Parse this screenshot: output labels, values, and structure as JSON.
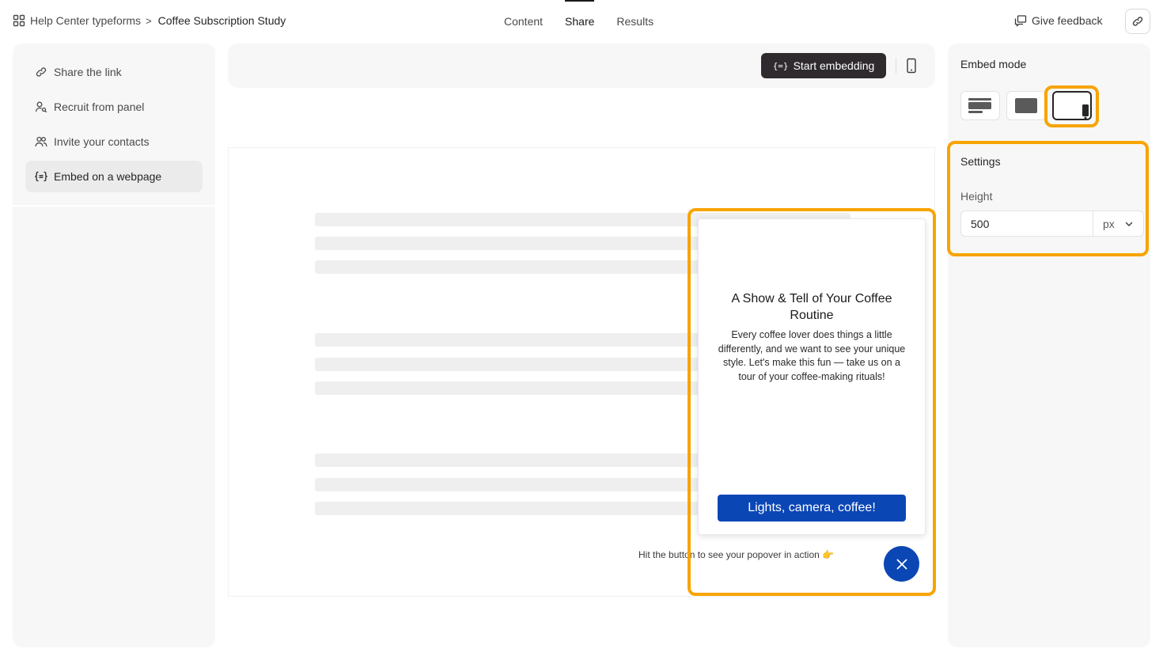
{
  "header": {
    "breadcrumb": {
      "workspace": "Help Center typeforms",
      "separator": ">",
      "form": "Coffee Subscription Study"
    },
    "tabs": [
      {
        "label": "Content",
        "active": false
      },
      {
        "label": "Share",
        "active": true
      },
      {
        "label": "Results",
        "active": false
      }
    ],
    "feedback_label": "Give feedback"
  },
  "sidebar": {
    "items": [
      {
        "label": "Share the link",
        "icon": "link-icon",
        "active": false
      },
      {
        "label": "Recruit from panel",
        "icon": "person-search-icon",
        "active": false
      },
      {
        "label": "Invite your contacts",
        "icon": "contacts-icon",
        "active": false
      },
      {
        "label": "Embed on a webpage",
        "icon": "embed-icon",
        "active": true
      }
    ]
  },
  "toolbar": {
    "start_embedding_icon": "{=}",
    "start_embedding_label": "Start embedding"
  },
  "preview": {
    "popover": {
      "title": "A Show & Tell of Your Coffee Routine",
      "body": "Every coffee lover does things a little differently, and we want to see your unique style. Let's make this fun — take us on a tour of your coffee-making rituals!",
      "cta_label": "Lights, camera, coffee!"
    },
    "hint": "Hit the button to see your popover in action 👉"
  },
  "embed_panel": {
    "title": "Embed mode",
    "modes": [
      {
        "icon": "standard-embed-icon",
        "selected": false
      },
      {
        "icon": "fullpage-embed-icon",
        "selected": false
      },
      {
        "icon": "popover-embed-icon",
        "selected": true
      }
    ],
    "settings_title": "Settings",
    "height_label": "Height",
    "height_value": "500",
    "height_unit": "px"
  },
  "colors": {
    "highlight": "#f7a400",
    "brand_blue": "#0b46b5",
    "dark_button": "#2e2a2e",
    "panel_bg": "#f7f7f7"
  }
}
